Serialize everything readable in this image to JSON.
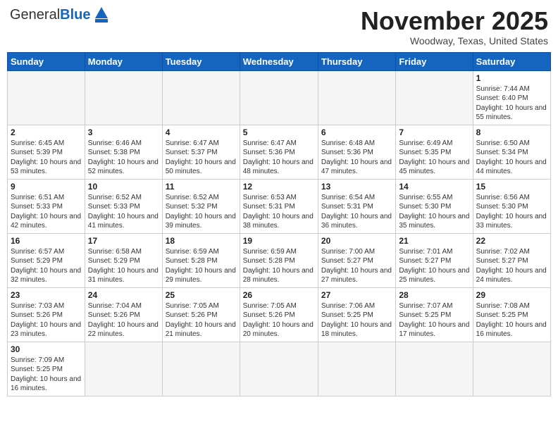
{
  "header": {
    "logo": {
      "general": "General",
      "blue": "Blue"
    },
    "title": "November 2025",
    "location": "Woodway, Texas, United States"
  },
  "days_of_week": [
    "Sunday",
    "Monday",
    "Tuesday",
    "Wednesday",
    "Thursday",
    "Friday",
    "Saturday"
  ],
  "weeks": [
    [
      {
        "day": "",
        "info": ""
      },
      {
        "day": "",
        "info": ""
      },
      {
        "day": "",
        "info": ""
      },
      {
        "day": "",
        "info": ""
      },
      {
        "day": "",
        "info": ""
      },
      {
        "day": "",
        "info": ""
      },
      {
        "day": "1",
        "info": "Sunrise: 7:44 AM\nSunset: 6:40 PM\nDaylight: 10 hours and 55 minutes."
      }
    ],
    [
      {
        "day": "2",
        "info": "Sunrise: 6:45 AM\nSunset: 5:39 PM\nDaylight: 10 hours and 53 minutes."
      },
      {
        "day": "3",
        "info": "Sunrise: 6:46 AM\nSunset: 5:38 PM\nDaylight: 10 hours and 52 minutes."
      },
      {
        "day": "4",
        "info": "Sunrise: 6:47 AM\nSunset: 5:37 PM\nDaylight: 10 hours and 50 minutes."
      },
      {
        "day": "5",
        "info": "Sunrise: 6:47 AM\nSunset: 5:36 PM\nDaylight: 10 hours and 48 minutes."
      },
      {
        "day": "6",
        "info": "Sunrise: 6:48 AM\nSunset: 5:36 PM\nDaylight: 10 hours and 47 minutes."
      },
      {
        "day": "7",
        "info": "Sunrise: 6:49 AM\nSunset: 5:35 PM\nDaylight: 10 hours and 45 minutes."
      },
      {
        "day": "8",
        "info": "Sunrise: 6:50 AM\nSunset: 5:34 PM\nDaylight: 10 hours and 44 minutes."
      }
    ],
    [
      {
        "day": "9",
        "info": "Sunrise: 6:51 AM\nSunset: 5:33 PM\nDaylight: 10 hours and 42 minutes."
      },
      {
        "day": "10",
        "info": "Sunrise: 6:52 AM\nSunset: 5:33 PM\nDaylight: 10 hours and 41 minutes."
      },
      {
        "day": "11",
        "info": "Sunrise: 6:52 AM\nSunset: 5:32 PM\nDaylight: 10 hours and 39 minutes."
      },
      {
        "day": "12",
        "info": "Sunrise: 6:53 AM\nSunset: 5:31 PM\nDaylight: 10 hours and 38 minutes."
      },
      {
        "day": "13",
        "info": "Sunrise: 6:54 AM\nSunset: 5:31 PM\nDaylight: 10 hours and 36 minutes."
      },
      {
        "day": "14",
        "info": "Sunrise: 6:55 AM\nSunset: 5:30 PM\nDaylight: 10 hours and 35 minutes."
      },
      {
        "day": "15",
        "info": "Sunrise: 6:56 AM\nSunset: 5:30 PM\nDaylight: 10 hours and 33 minutes."
      }
    ],
    [
      {
        "day": "16",
        "info": "Sunrise: 6:57 AM\nSunset: 5:29 PM\nDaylight: 10 hours and 32 minutes."
      },
      {
        "day": "17",
        "info": "Sunrise: 6:58 AM\nSunset: 5:29 PM\nDaylight: 10 hours and 31 minutes."
      },
      {
        "day": "18",
        "info": "Sunrise: 6:59 AM\nSunset: 5:28 PM\nDaylight: 10 hours and 29 minutes."
      },
      {
        "day": "19",
        "info": "Sunrise: 6:59 AM\nSunset: 5:28 PM\nDaylight: 10 hours and 28 minutes."
      },
      {
        "day": "20",
        "info": "Sunrise: 7:00 AM\nSunset: 5:27 PM\nDaylight: 10 hours and 27 minutes."
      },
      {
        "day": "21",
        "info": "Sunrise: 7:01 AM\nSunset: 5:27 PM\nDaylight: 10 hours and 25 minutes."
      },
      {
        "day": "22",
        "info": "Sunrise: 7:02 AM\nSunset: 5:27 PM\nDaylight: 10 hours and 24 minutes."
      }
    ],
    [
      {
        "day": "23",
        "info": "Sunrise: 7:03 AM\nSunset: 5:26 PM\nDaylight: 10 hours and 23 minutes."
      },
      {
        "day": "24",
        "info": "Sunrise: 7:04 AM\nSunset: 5:26 PM\nDaylight: 10 hours and 22 minutes."
      },
      {
        "day": "25",
        "info": "Sunrise: 7:05 AM\nSunset: 5:26 PM\nDaylight: 10 hours and 21 minutes."
      },
      {
        "day": "26",
        "info": "Sunrise: 7:05 AM\nSunset: 5:26 PM\nDaylight: 10 hours and 20 minutes."
      },
      {
        "day": "27",
        "info": "Sunrise: 7:06 AM\nSunset: 5:25 PM\nDaylight: 10 hours and 18 minutes."
      },
      {
        "day": "28",
        "info": "Sunrise: 7:07 AM\nSunset: 5:25 PM\nDaylight: 10 hours and 17 minutes."
      },
      {
        "day": "29",
        "info": "Sunrise: 7:08 AM\nSunset: 5:25 PM\nDaylight: 10 hours and 16 minutes."
      }
    ],
    [
      {
        "day": "30",
        "info": "Sunrise: 7:09 AM\nSunset: 5:25 PM\nDaylight: 10 hours and 16 minutes."
      },
      {
        "day": "",
        "info": ""
      },
      {
        "day": "",
        "info": ""
      },
      {
        "day": "",
        "info": ""
      },
      {
        "day": "",
        "info": ""
      },
      {
        "day": "",
        "info": ""
      },
      {
        "day": "",
        "info": ""
      }
    ]
  ]
}
